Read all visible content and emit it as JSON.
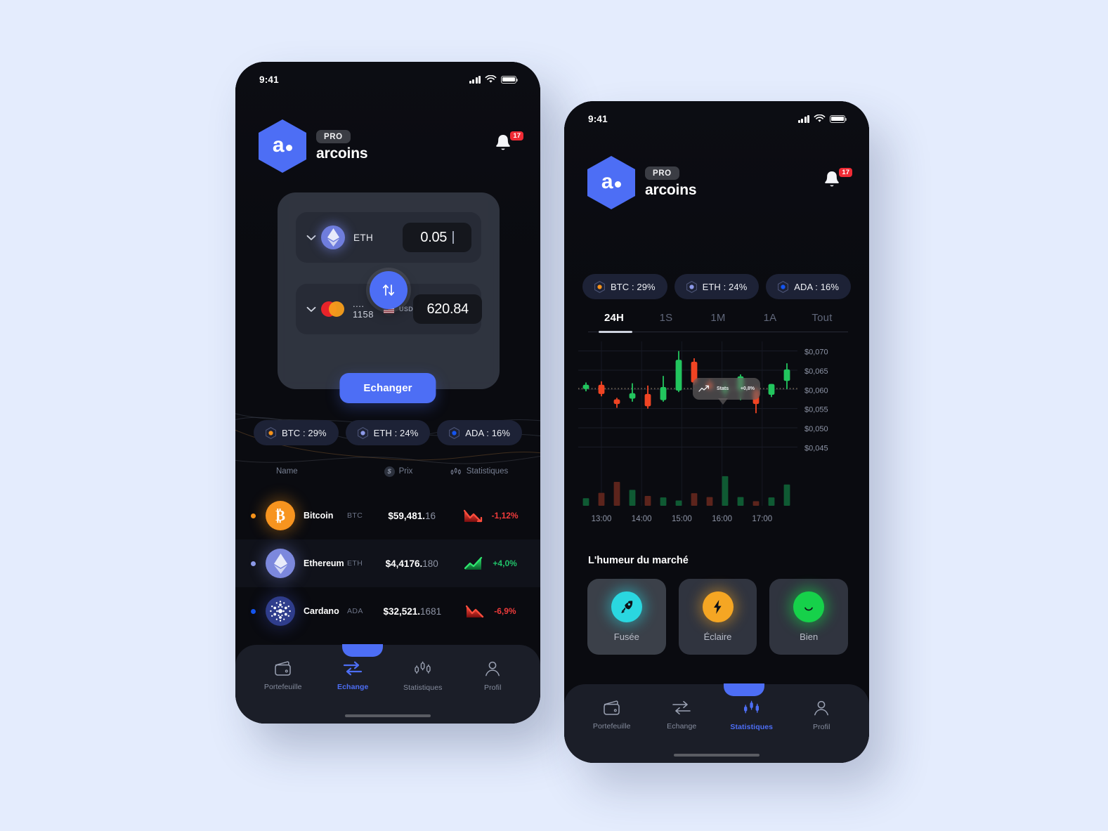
{
  "page": {
    "background": "#e4ecfd"
  },
  "brand": {
    "pro_label": "PRO",
    "name": "arcoins",
    "logo_letter": "a",
    "notification_count": "17"
  },
  "statusbar": {
    "time": "9:41"
  },
  "phone_a": {
    "exchange": {
      "from": {
        "asset": "ETH",
        "amount": "0.05"
      },
      "to": {
        "card_digits": ".... 1158",
        "currency": "USD",
        "amount": "620.84"
      },
      "swap_icon": "swap-vertical-icon",
      "submit_label": "Echanger"
    },
    "pills": [
      {
        "label": "BTC : 29%",
        "color": "#f7931a"
      },
      {
        "label": "ETH : 24%",
        "color": "#8d9ae8"
      },
      {
        "label": "ADA : 16%",
        "color": "#1455f0"
      }
    ],
    "table": {
      "headers": {
        "name": "Name",
        "price": "Prix",
        "stats": "Statistiques"
      },
      "rows": [
        {
          "name": "Bitcoin",
          "symbol": "BTC",
          "price_main": "$59,481.",
          "price_dec": "16",
          "change": "-1,12%",
          "direction": "down",
          "dot": "#f7931a",
          "color": "#ef3b3b"
        },
        {
          "name": "Ethereum",
          "symbol": "ETH",
          "price_main": "$4,4176.",
          "price_dec": "180",
          "change": "+4,0%",
          "direction": "up",
          "dot": "#8d9ae8",
          "color": "#21c26a"
        },
        {
          "name": "Cardano",
          "symbol": "ADA",
          "price_main": "$32,521.",
          "price_dec": "1681",
          "change": "-6,9%",
          "direction": "down",
          "dot": "#1455f0",
          "color": "#ef3b3b"
        }
      ]
    },
    "tabbar": {
      "active": "Echange",
      "items": [
        {
          "label": "Portefeuille",
          "icon": "wallet-icon"
        },
        {
          "label": "Echange",
          "icon": "exchange-arrows-icon"
        },
        {
          "label": "Statistiques",
          "icon": "candlestick-icon"
        },
        {
          "label": "Profil",
          "icon": "person-icon"
        }
      ]
    }
  },
  "phone_b": {
    "pills": [
      {
        "label": "BTC : 29%",
        "color": "#f7931a"
      },
      {
        "label": "ETH : 24%",
        "color": "#8d9ae8"
      },
      {
        "label": "ADA : 16%",
        "color": "#1455f0"
      }
    ],
    "time_tabs": {
      "active": "24H",
      "items": [
        "24H",
        "1S",
        "1M",
        "1A",
        "Tout"
      ]
    },
    "tooltip": {
      "label": "Stats",
      "value": "+0,8%",
      "icon": "trend-up-icon"
    },
    "mood": {
      "title": "L'humeur du marché",
      "options": [
        {
          "label": "Fusée",
          "icon": "rocket-icon",
          "color": "#2ad7e0",
          "selected": true
        },
        {
          "label": "Éclaire",
          "icon": "bolt-icon",
          "color": "#f5a623",
          "selected": false
        },
        {
          "label": "Bien",
          "icon": "smiley-icon",
          "color": "#16d14a",
          "selected": false
        }
      ]
    },
    "tabbar": {
      "active": "Statistiques",
      "items": [
        {
          "label": "Portefeuille",
          "icon": "wallet-icon"
        },
        {
          "label": "Echange",
          "icon": "exchange-arrows-icon"
        },
        {
          "label": "Statistiques",
          "icon": "candlestick-icon"
        },
        {
          "label": "Profil",
          "icon": "person-icon"
        }
      ]
    }
  },
  "chart_data": {
    "type": "candlestick",
    "title": "",
    "xlabel": "",
    "ylabel": "",
    "grid": true,
    "ylim": [
      0.0425,
      0.0725
    ],
    "y_ticks": [
      "$0,070",
      "$0,065",
      "$0,060",
      "$0,055",
      "$0,050",
      "$0,045"
    ],
    "y_tick_values": [
      0.07,
      0.065,
      0.06,
      0.055,
      0.05,
      0.045
    ],
    "x_ticks": [
      "13:00",
      "14:00",
      "15:00",
      "16:00",
      "17:00"
    ],
    "reference_line": 0.0602,
    "up_color": "#22c55e",
    "down_color": "#f04423",
    "candles": [
      {
        "t": "12:50",
        "o": 0.0601,
        "h": 0.0618,
        "l": 0.0595,
        "c": 0.0612,
        "dir": "up",
        "vol": 0.2
      },
      {
        "t": "13:05",
        "o": 0.0612,
        "h": 0.0621,
        "l": 0.0582,
        "c": 0.0588,
        "dir": "down",
        "vol": 0.34
      },
      {
        "t": "13:20",
        "o": 0.0574,
        "h": 0.0578,
        "l": 0.0552,
        "c": 0.0562,
        "dir": "down",
        "vol": 0.63
      },
      {
        "t": "13:40",
        "o": 0.0576,
        "h": 0.0616,
        "l": 0.0568,
        "c": 0.059,
        "dir": "up",
        "vol": 0.42
      },
      {
        "t": "14:00",
        "o": 0.0588,
        "h": 0.061,
        "l": 0.055,
        "c": 0.0556,
        "dir": "down",
        "vol": 0.26
      },
      {
        "t": "14:20",
        "o": 0.0572,
        "h": 0.0635,
        "l": 0.0568,
        "c": 0.0606,
        "dir": "up",
        "vol": 0.22
      },
      {
        "t": "14:40",
        "o": 0.0597,
        "h": 0.07,
        "l": 0.0593,
        "c": 0.0677,
        "dir": "up",
        "vol": 0.14
      },
      {
        "t": "15:00",
        "o": 0.0672,
        "h": 0.0681,
        "l": 0.0612,
        "c": 0.0618,
        "dir": "down",
        "vol": 0.33
      },
      {
        "t": "15:20",
        "o": 0.0618,
        "h": 0.0626,
        "l": 0.0596,
        "c": 0.0602,
        "dir": "down",
        "vol": 0.23
      },
      {
        "t": "15:40",
        "o": 0.0592,
        "h": 0.0622,
        "l": 0.058,
        "c": 0.0604,
        "dir": "up",
        "vol": 0.78
      },
      {
        "t": "16:00",
        "o": 0.0634,
        "h": 0.0639,
        "l": 0.0572,
        "c": 0.0598,
        "dir": "up",
        "vol": 0.23
      },
      {
        "t": "16:20",
        "o": 0.0598,
        "h": 0.0606,
        "l": 0.0538,
        "c": 0.0562,
        "dir": "down",
        "vol": 0.12
      },
      {
        "t": "16:40",
        "o": 0.0586,
        "h": 0.0614,
        "l": 0.058,
        "c": 0.0614,
        "dir": "up",
        "vol": 0.22
      },
      {
        "t": "17:00",
        "o": 0.0622,
        "h": 0.0668,
        "l": 0.0601,
        "c": 0.0652,
        "dir": "up",
        "vol": 0.56
      }
    ]
  }
}
